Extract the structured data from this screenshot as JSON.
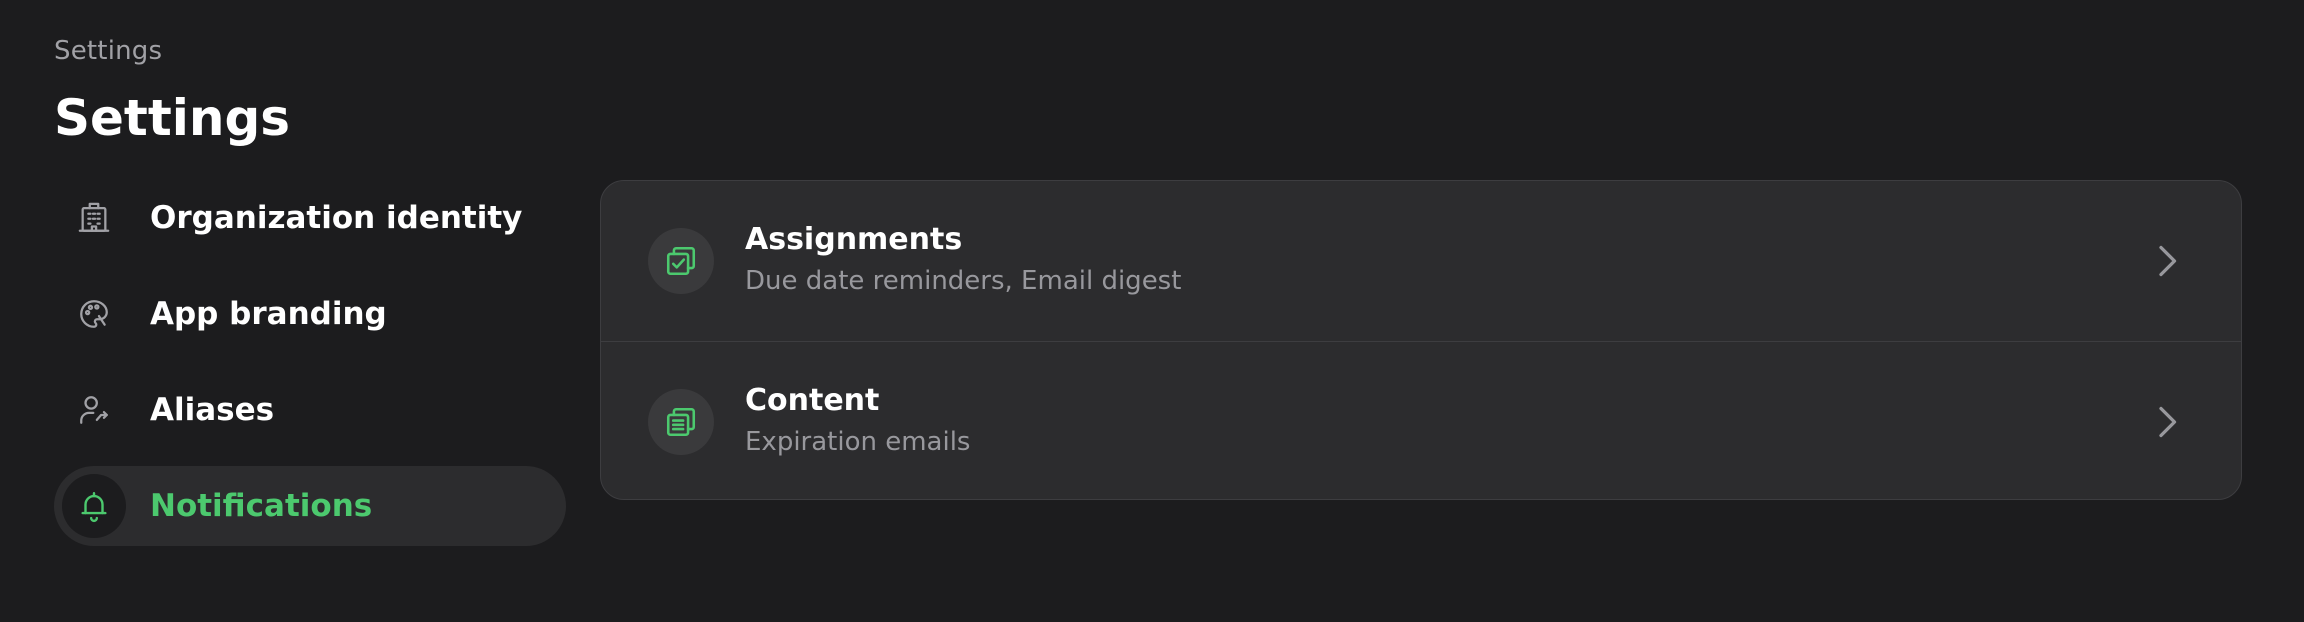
{
  "breadcrumb": "Settings",
  "title": "Settings",
  "sidebar": {
    "items": [
      {
        "label": "Organization identity",
        "icon": "building-icon",
        "active": false
      },
      {
        "label": "App branding",
        "icon": "palette-icon",
        "active": false
      },
      {
        "label": "Aliases",
        "icon": "user-arrow-icon",
        "active": false
      },
      {
        "label": "Notifications",
        "icon": "bell-icon",
        "active": true
      }
    ]
  },
  "notifications": {
    "rows": [
      {
        "title": "Assignments",
        "subtitle": "Due date reminders, Email digest",
        "icon": "checklist-icon"
      },
      {
        "title": "Content",
        "subtitle": "Expiration emails",
        "icon": "documents-icon"
      }
    ]
  },
  "colors": {
    "background": "#1c1c1e",
    "surface": "#2c2c2e",
    "accent": "#4cc96e",
    "muted_text": "#98989d"
  }
}
